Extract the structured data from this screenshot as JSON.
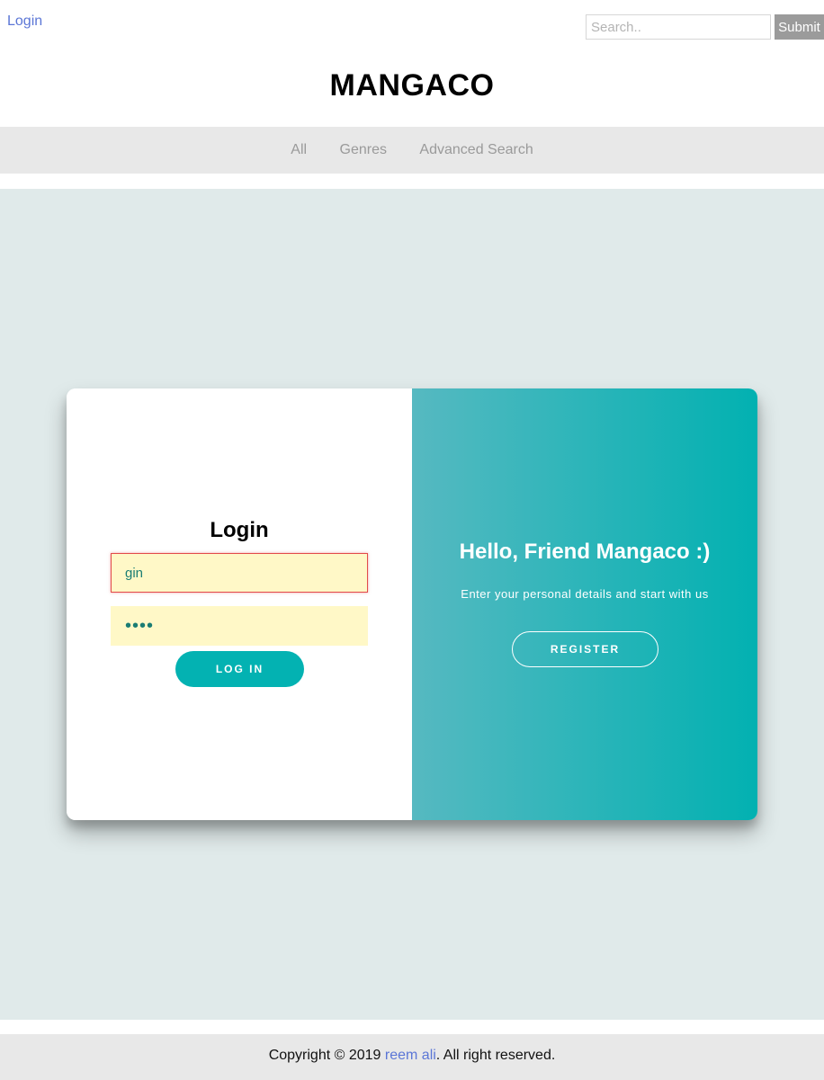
{
  "header": {
    "login_link": "Login",
    "search_placeholder": "Search..",
    "submit_label": "Submit",
    "brand": "MANGACO"
  },
  "nav": {
    "items": [
      "All",
      "Genres",
      "Advanced Search"
    ]
  },
  "login_form": {
    "title": "Login",
    "username_value": "gin",
    "password_value": "gin1",
    "login_button": "LOG IN"
  },
  "welcome_panel": {
    "title": "Hello, Friend Mangaco :)",
    "subtitle": "Enter your personal details and start with us",
    "register_button": "REGISTER"
  },
  "footer": {
    "prefix": "Copyright © 2019 ",
    "author": "reem ali",
    "suffix": ". All right reserved."
  },
  "colors": {
    "accent": "#03b2b2",
    "gradient_start": "#56b9c1",
    "gradient_end": "#02b1b1",
    "link": "#5b76d6",
    "input_bg": "#fff8c7",
    "main_bg": "#e0eaea"
  }
}
